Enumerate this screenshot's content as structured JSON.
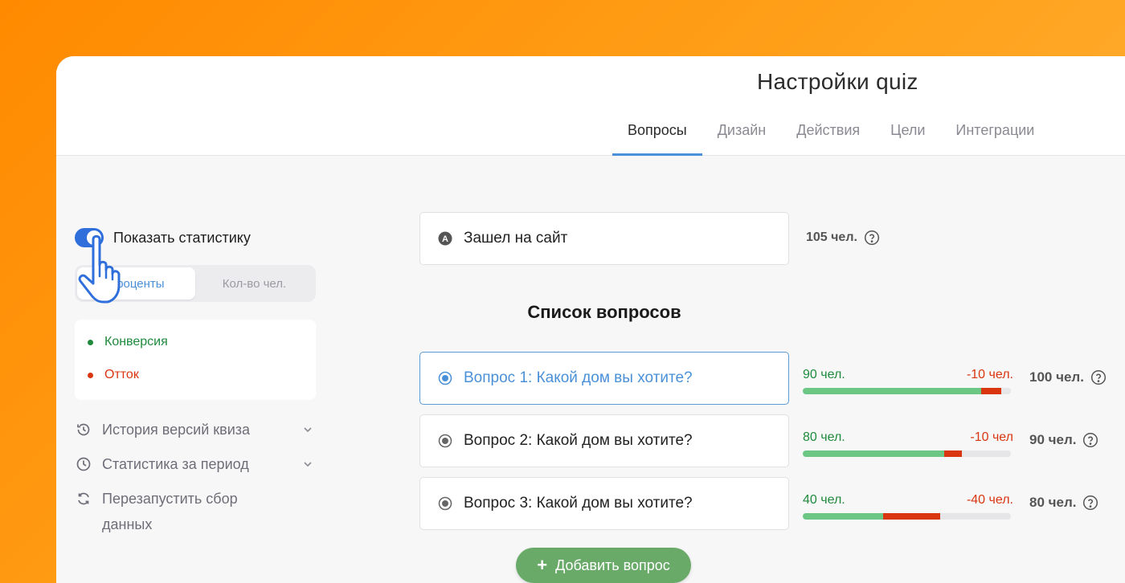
{
  "header": {
    "title": "Настройки quiz",
    "tabs": [
      {
        "label": "Вопросы",
        "active": true
      },
      {
        "label": "Дизайн"
      },
      {
        "label": "Действия"
      },
      {
        "label": "Цели"
      },
      {
        "label": "Интеграции"
      }
    ]
  },
  "sidebar": {
    "toggle_label": "Показать статистику",
    "toggle_on": true,
    "segments": [
      {
        "label": "Проценты",
        "active": true
      },
      {
        "label": "Кол-во чел."
      }
    ],
    "legend": [
      {
        "label": "Конверсия",
        "color": "#1f8a3c"
      },
      {
        "label": "Отток",
        "color": "#d9360f"
      }
    ],
    "menu": [
      {
        "label": "История версий квиза",
        "icon": "history-icon",
        "expandable": true
      },
      {
        "label": "Статистика за период",
        "icon": "clock-icon",
        "expandable": true
      },
      {
        "label": "Перезапустить сбор данных",
        "icon": "refresh-icon",
        "expandable": false
      }
    ]
  },
  "main": {
    "entry": {
      "label": "Зашел на сайт",
      "count": "105 чел."
    },
    "section_title": "Список вопросов",
    "questions": [
      {
        "label": "Вопрос 1: Какой дом вы хотите?",
        "selected": true,
        "pos_label": "90 чел.",
        "neg_label": "-10 чел.",
        "pos": 90,
        "neg": 10,
        "base": 105,
        "total": "100 чел."
      },
      {
        "label": "Вопрос 2: Какой дом вы хотите?",
        "selected": false,
        "pos_label": "80 чел.",
        "neg_label": "-10 чел",
        "pos": 80,
        "neg": 10,
        "base": 118,
        "total": "90 чел."
      },
      {
        "label": "Вопрос 3: Какой дом вы хотите?",
        "selected": false,
        "pos_label": "40 чел.",
        "neg_label": "-40 чел.",
        "pos": 40,
        "neg": 28,
        "base": 103,
        "total": "80 чел."
      }
    ],
    "add_button": "Добавить вопрос"
  },
  "colors": {
    "accent": "#4a90d9",
    "toggle": "#2f6fdb",
    "conversion": "#6cc785",
    "churn": "#d9360f",
    "add_button": "#6aaa69"
  }
}
